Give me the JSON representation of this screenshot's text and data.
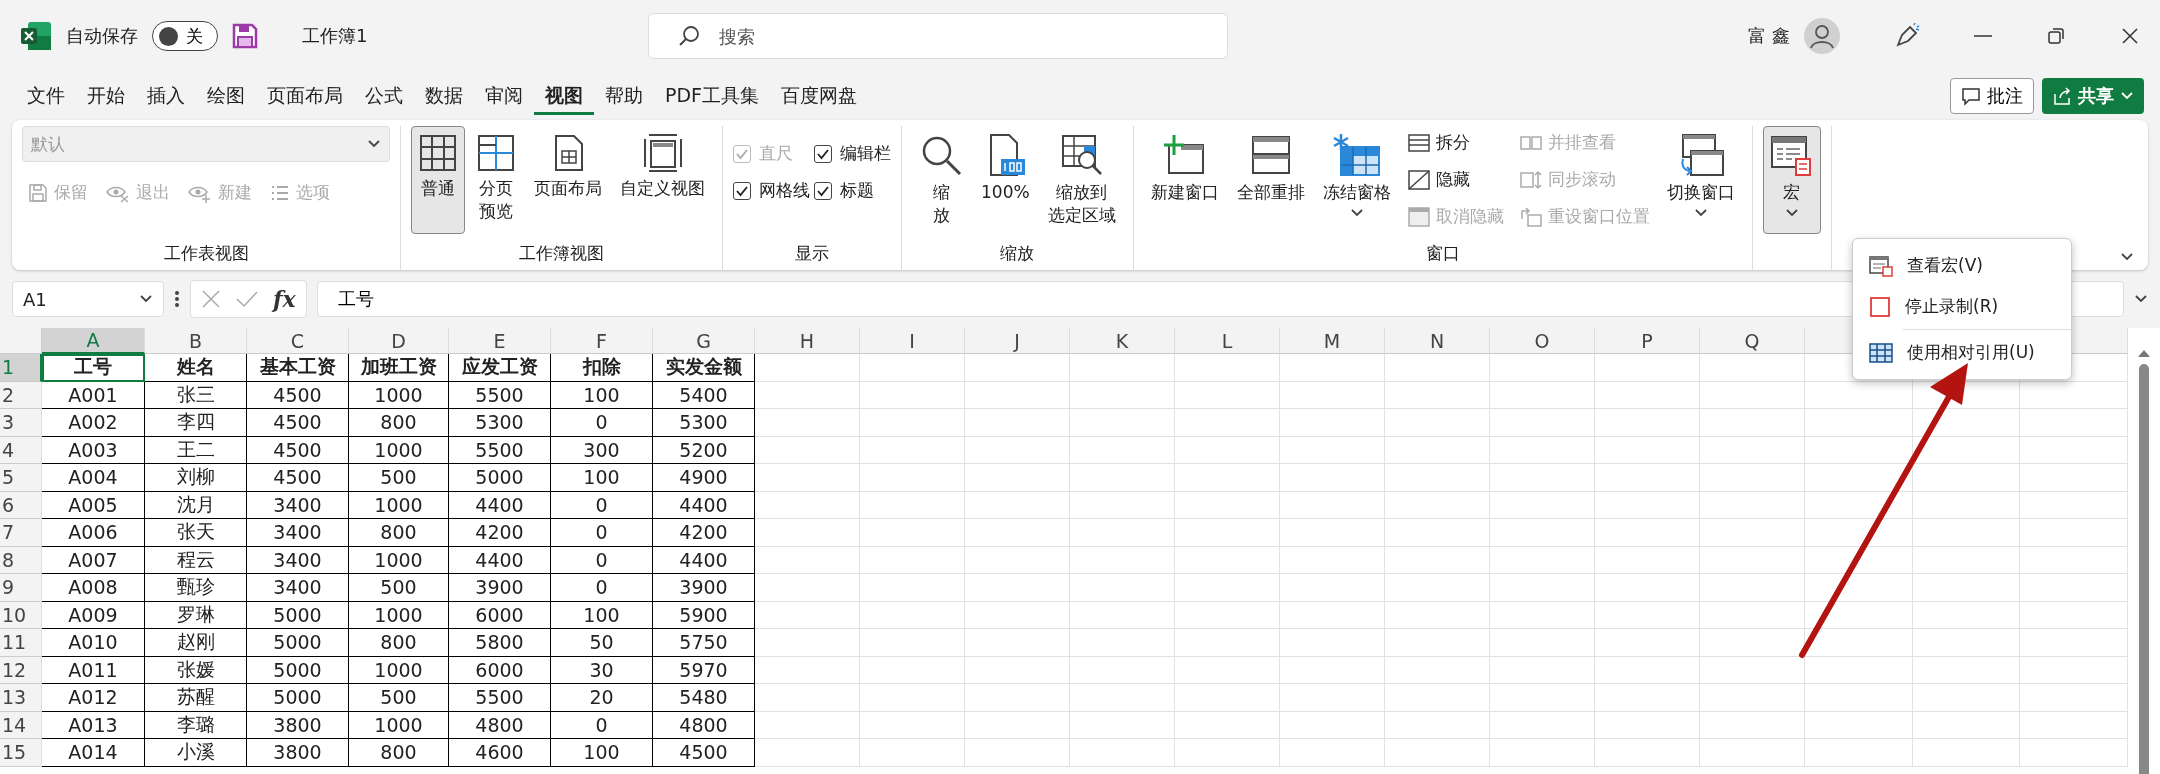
{
  "title_bar": {
    "autosave_label": "自动保存",
    "autosave": {
      "on": false,
      "label": "关"
    },
    "workbook": "工作簿1",
    "search": {
      "placeholder": "搜索"
    },
    "user": "富 鑫"
  },
  "tabs": [
    {
      "label": "文件",
      "selected": false
    },
    {
      "label": "开始",
      "selected": false
    },
    {
      "label": "插入",
      "selected": false
    },
    {
      "label": "绘图",
      "selected": false
    },
    {
      "label": "页面布局",
      "selected": false
    },
    {
      "label": "公式",
      "selected": false
    },
    {
      "label": "数据",
      "selected": false
    },
    {
      "label": "审阅",
      "selected": false
    },
    {
      "label": "视图",
      "selected": true
    },
    {
      "label": "帮助",
      "selected": false
    },
    {
      "label": "PDF工具集",
      "selected": false
    },
    {
      "label": "百度网盘",
      "selected": false
    }
  ],
  "comment_button": "批注",
  "share_button": "共享",
  "ribbon": {
    "groups": [
      {
        "label": "工作表视图",
        "columns": [
          {
            "items": [
              {
                "kind": "dropdown",
                "value": "默认",
                "disabled": true
              },
              {
                "kind": "row",
                "items": [
                  {
                    "kind": "small",
                    "label": "保留",
                    "disabled": true
                  },
                  {
                    "kind": "small",
                    "label": "退出",
                    "disabled": true
                  },
                  {
                    "kind": "small",
                    "label": "新建",
                    "disabled": true
                  },
                  {
                    "kind": "small",
                    "label": "选项",
                    "disabled": true
                  }
                ]
              }
            ]
          }
        ]
      },
      {
        "label": "工作簿视图",
        "columns": [
          {
            "items": [
              {
                "kind": "large",
                "label": "普通",
                "selected": true
              }
            ]
          },
          {
            "items": [
              {
                "kind": "large",
                "lines": [
                  "分页",
                  "预览"
                ],
                "selected": false
              }
            ]
          },
          {
            "items": [
              {
                "kind": "large",
                "label": "页面布局",
                "selected": false
              }
            ]
          },
          {
            "items": [
              {
                "kind": "large",
                "label": "自定义视图",
                "selected": false
              }
            ]
          }
        ]
      },
      {
        "label": "显示",
        "columns": [
          {
            "items": [
              {
                "kind": "check",
                "label": "直尺",
                "checked": true,
                "disabled": true
              },
              {
                "kind": "check",
                "label": "网格线",
                "checked": true,
                "disabled": false
              }
            ]
          },
          {
            "items": [
              {
                "kind": "check",
                "label": "编辑栏",
                "checked": true,
                "disabled": false
              },
              {
                "kind": "check",
                "label": "标题",
                "checked": true,
                "disabled": false
              }
            ]
          }
        ]
      },
      {
        "label": "缩放",
        "columns": [
          {
            "items": [
              {
                "kind": "large",
                "lines": [
                  "缩",
                  "放"
                ],
                "selected": false
              }
            ]
          },
          {
            "items": [
              {
                "kind": "large",
                "label": "100%",
                "selected": false
              }
            ]
          },
          {
            "items": [
              {
                "kind": "large",
                "lines": [
                  "缩放到",
                  "选定区域"
                ],
                "selected": false
              }
            ]
          }
        ]
      },
      {
        "label": "窗口",
        "columns": [
          {
            "items": [
              {
                "kind": "large",
                "label": "新建窗口",
                "selected": false
              }
            ]
          },
          {
            "items": [
              {
                "kind": "large",
                "label": "全部重排",
                "selected": false
              }
            ]
          },
          {
            "items": [
              {
                "kind": "large",
                "label": "冻结窗格",
                "selected": false,
                "menu": true
              }
            ]
          },
          {
            "items": [
              {
                "kind": "small",
                "label": "拆分",
                "disabled": false
              },
              {
                "kind": "small",
                "label": "隐藏",
                "disabled": false
              },
              {
                "kind": "small",
                "label": "取消隐藏",
                "disabled": true
              }
            ]
          },
          {
            "items": [
              {
                "kind": "small",
                "label": "并排查看",
                "disabled": true
              },
              {
                "kind": "small",
                "label": "同步滚动",
                "disabled": true
              },
              {
                "kind": "small",
                "label": "重设窗口位置",
                "disabled": true
              }
            ]
          },
          {
            "items": [
              {
                "kind": "large",
                "label": "切换窗口",
                "selected": false,
                "menu": true
              }
            ]
          }
        ]
      },
      {
        "columns": [
          {
            "items": [
              {
                "kind": "large",
                "label": "宏",
                "selected": true,
                "menu": true
              }
            ]
          }
        ]
      }
    ]
  },
  "formula_bar": {
    "name_box": "A1",
    "fx": "fx",
    "value": "工号"
  },
  "table": {
    "columns": [
      {
        "label": "A",
        "selected": true
      },
      {
        "label": "B",
        "selected": false
      },
      {
        "label": "C",
        "selected": false
      },
      {
        "label": "D",
        "selected": false
      },
      {
        "label": "E",
        "selected": false
      },
      {
        "label": "F",
        "selected": false
      },
      {
        "label": "G",
        "selected": false
      },
      {
        "label": "H",
        "selected": false
      },
      {
        "label": "I",
        "selected": false
      },
      {
        "label": "J",
        "selected": false
      },
      {
        "label": "K",
        "selected": false
      },
      {
        "label": "L",
        "selected": false
      },
      {
        "label": "M",
        "selected": false
      },
      {
        "label": "N",
        "selected": false
      },
      {
        "label": "O",
        "selected": false
      },
      {
        "label": "P",
        "selected": false
      },
      {
        "label": "Q",
        "selected": false
      }
    ],
    "rows": [
      {
        "number": "1",
        "selected": true,
        "header": true,
        "cells": [
          "工号",
          "姓名",
          "基本工资",
          "加班工资",
          "应发工资",
          "扣除",
          "实发金额"
        ]
      },
      {
        "number": "2",
        "selected": false,
        "header": false,
        "cells": [
          "A001",
          "张三",
          "4500",
          "1000",
          "5500",
          "100",
          "5400"
        ]
      },
      {
        "number": "3",
        "selected": false,
        "header": false,
        "cells": [
          "A002",
          "李四",
          "4500",
          "800",
          "5300",
          "0",
          "5300"
        ]
      },
      {
        "number": "4",
        "selected": false,
        "header": false,
        "cells": [
          "A003",
          "王二",
          "4500",
          "1000",
          "5500",
          "300",
          "5200"
        ]
      },
      {
        "number": "5",
        "selected": false,
        "header": false,
        "cells": [
          "A004",
          "刘柳",
          "4500",
          "500",
          "5000",
          "100",
          "4900"
        ]
      },
      {
        "number": "6",
        "selected": false,
        "header": false,
        "cells": [
          "A005",
          "沈月",
          "3400",
          "1000",
          "4400",
          "0",
          "4400"
        ]
      },
      {
        "number": "7",
        "selected": false,
        "header": false,
        "cells": [
          "A006",
          "张天",
          "3400",
          "800",
          "4200",
          "0",
          "4200"
        ]
      },
      {
        "number": "8",
        "selected": false,
        "header": false,
        "cells": [
          "A007",
          "程云",
          "3400",
          "1000",
          "4400",
          "0",
          "4400"
        ]
      },
      {
        "number": "9",
        "selected": false,
        "header": false,
        "cells": [
          "A008",
          "甄珍",
          "3400",
          "500",
          "3900",
          "0",
          "3900"
        ]
      },
      {
        "number": "10",
        "selected": false,
        "header": false,
        "cells": [
          "A009",
          "罗琳",
          "5000",
          "1000",
          "6000",
          "100",
          "5900"
        ]
      },
      {
        "number": "11",
        "selected": false,
        "header": false,
        "cells": [
          "A010",
          "赵刚",
          "5000",
          "800",
          "5800",
          "50",
          "5750"
        ]
      },
      {
        "number": "12",
        "selected": false,
        "header": false,
        "cells": [
          "A011",
          "张媛",
          "5000",
          "1000",
          "6000",
          "30",
          "5970"
        ]
      },
      {
        "number": "13",
        "selected": false,
        "header": false,
        "cells": [
          "A012",
          "苏醒",
          "5000",
          "500",
          "5500",
          "20",
          "5480"
        ]
      },
      {
        "number": "14",
        "selected": false,
        "header": false,
        "cells": [
          "A013",
          "李璐",
          "3800",
          "1000",
          "4800",
          "0",
          "4800"
        ]
      },
      {
        "number": "15",
        "selected": false,
        "header": false,
        "cells": [
          "A014",
          "小溪",
          "3800",
          "800",
          "4600",
          "100",
          "4500"
        ]
      }
    ]
  },
  "macro_menu": {
    "items": [
      {
        "label": "查看宏(V)"
      },
      {
        "label": "停止录制(R)"
      },
      {
        "label": "使用相对引用(U)"
      }
    ]
  }
}
